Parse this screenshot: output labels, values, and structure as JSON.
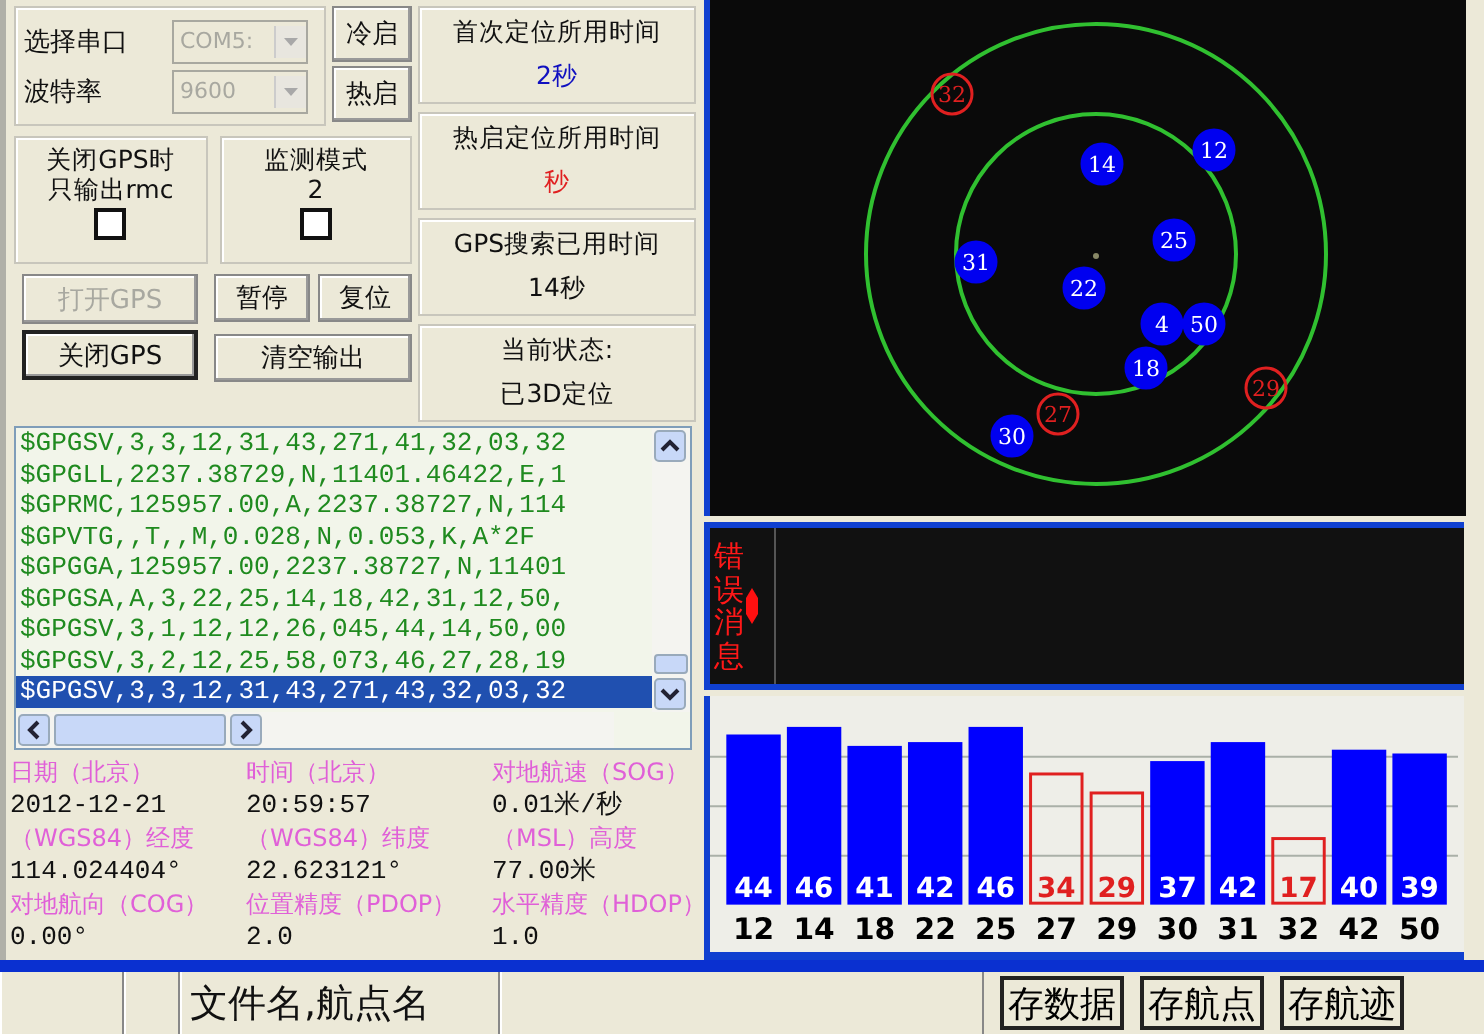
{
  "port": {
    "fields": [
      {
        "label": "选择串口",
        "value": "COM5:",
        "disabled": true
      },
      {
        "label": "波特率",
        "value": "9600",
        "disabled": true
      }
    ]
  },
  "start_buttons": [
    {
      "label": "冷启",
      "disabled": false,
      "default": false
    },
    {
      "label": "热启",
      "disabled": false,
      "default": false
    }
  ],
  "options": [
    {
      "label_lines": [
        "关闭GPS时",
        "只输出rmc"
      ],
      "checked": false
    },
    {
      "label_lines": [
        "监测模式",
        "2"
      ],
      "checked": false
    }
  ],
  "gps_buttons": [
    {
      "label": "打开GPS",
      "disabled": true,
      "default": false
    },
    {
      "label": "关闭GPS",
      "disabled": false,
      "default": true
    }
  ],
  "action_buttons": [
    {
      "label": "暂停",
      "disabled": false,
      "default": false
    },
    {
      "label": "复位",
      "disabled": false,
      "default": false
    },
    {
      "label": "清空输出",
      "disabled": false,
      "default": false
    }
  ],
  "status_boxes": [
    {
      "title": "首次定位所用时间",
      "value": "2秒",
      "color": "#1010c0"
    },
    {
      "title": "热启定位所用时间",
      "value": "秒",
      "color": "#e02020"
    },
    {
      "title": "GPS搜索已用时间",
      "value": "14秒",
      "color": "#101010"
    },
    {
      "title": "当前状态:",
      "value": "已3D定位",
      "color": "#101010"
    }
  ],
  "log": {
    "lines": [
      {
        "text": "$GPGSV,3,3,12,31,43,271,41,32,03,32",
        "selected": false
      },
      {
        "text": "$GPGLL,2237.38729,N,11401.46422,E,1",
        "selected": false
      },
      {
        "text": "$GPRMC,125957.00,A,2237.38727,N,114",
        "selected": false
      },
      {
        "text": "$GPVTG,,T,,M,0.028,N,0.053,K,A*2F",
        "selected": false
      },
      {
        "text": "$GPGGA,125957.00,2237.38727,N,11401",
        "selected": false
      },
      {
        "text": "$GPGSA,A,3,22,25,14,18,42,31,12,50,",
        "selected": false
      },
      {
        "text": "$GPGSV,3,1,12,12,26,045,44,14,50,00",
        "selected": false
      },
      {
        "text": "$GPGSV,3,2,12,25,58,073,46,27,28,19",
        "selected": false
      },
      {
        "text": "$GPGSV,3,3,12,31,43,271,43,32,03,32",
        "selected": true
      }
    ]
  },
  "info": [
    {
      "label": "日期（北京）",
      "value": "2012-12-21"
    },
    {
      "label": "时间（北京）",
      "value": "20:59:57"
    },
    {
      "label": "对地航速（SOG）",
      "value": "0.01米/秒"
    },
    {
      "label": "（WGS84）经度",
      "value": "114.024404°"
    },
    {
      "label": "（WGS84）纬度",
      "value": "22.623121°"
    },
    {
      "label": "（MSL）高度",
      "value": "77.00米"
    },
    {
      "label": "对地航向（COG）",
      "value": "0.00°"
    },
    {
      "label": "位置精度（PDOP）",
      "value": "2.0"
    },
    {
      "label": "水平精度（HDOP）",
      "value": "1.0"
    }
  ],
  "sky": {
    "satellites": [
      {
        "id": "32",
        "used": false
      },
      {
        "id": "14",
        "used": true
      },
      {
        "id": "12",
        "used": true
      },
      {
        "id": "25",
        "used": true
      },
      {
        "id": "31",
        "used": true
      },
      {
        "id": "22",
        "used": true
      },
      {
        "id": "4",
        "used": true
      },
      {
        "id": "50",
        "used": true
      },
      {
        "id": "18",
        "used": true
      },
      {
        "id": "29",
        "used": false
      },
      {
        "id": "27",
        "used": false
      },
      {
        "id": "30",
        "used": true
      }
    ]
  },
  "error_panel": {
    "label": "错误消息"
  },
  "signal": {
    "bars": [
      {
        "id": "12",
        "value": "44",
        "used": true
      },
      {
        "id": "14",
        "value": "46",
        "used": true
      },
      {
        "id": "18",
        "value": "41",
        "used": true
      },
      {
        "id": "22",
        "value": "42",
        "used": true
      },
      {
        "id": "25",
        "value": "46",
        "used": true
      },
      {
        "id": "27",
        "value": "34",
        "used": false
      },
      {
        "id": "29",
        "value": "29",
        "used": false
      },
      {
        "id": "30",
        "value": "37",
        "used": true
      },
      {
        "id": "31",
        "value": "42",
        "used": true
      },
      {
        "id": "32",
        "value": "17",
        "used": false
      },
      {
        "id": "42",
        "value": "40",
        "used": true
      },
      {
        "id": "50",
        "value": "39",
        "used": true
      }
    ]
  },
  "status_bar": {
    "file_label": "文件名,航点名",
    "buttons": [
      {
        "label": "存数据"
      },
      {
        "label": "存航点"
      },
      {
        "label": "存航迹"
      }
    ]
  }
}
